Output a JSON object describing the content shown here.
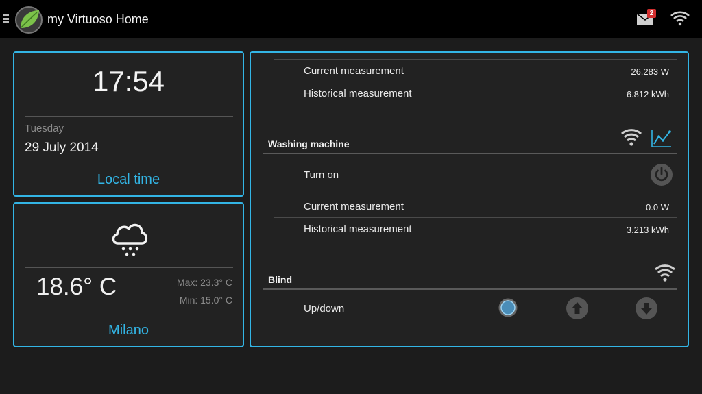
{
  "app": {
    "title": "my Virtuoso Home",
    "notification_count": "2",
    "accent_color": "#33b5e5"
  },
  "icons": {
    "menu": "menu-icon",
    "logo": "leaf-logo-icon",
    "mail": "mail-icon",
    "wifi": "wifi-icon",
    "chart": "chart-icon",
    "power": "power-icon",
    "up": "arrow-up-icon",
    "down": "arrow-down-icon",
    "weather": "rain-cloud-icon"
  },
  "clock": {
    "time": "17:54",
    "weekday": "Tuesday",
    "date": "29 July 2014",
    "label": "Local time"
  },
  "weather": {
    "temperature": "18.6° C",
    "max": "Max: 23.3° C",
    "min": "Min: 15.0° C",
    "city": "Milano"
  },
  "devices": {
    "top": {
      "current_label": "Current measurement",
      "current_value": "26.283 W",
      "historical_label": "Historical measurement",
      "historical_value": "6.812 kWh"
    },
    "washing_machine": {
      "title": "Washing machine",
      "turn_on_label": "Turn on",
      "current_label": "Current measurement",
      "current_value": "0.0 W",
      "historical_label": "Historical measurement",
      "historical_value": "3.213 kWh"
    },
    "blind": {
      "title": "Blind",
      "updown_label": "Up/down"
    }
  }
}
